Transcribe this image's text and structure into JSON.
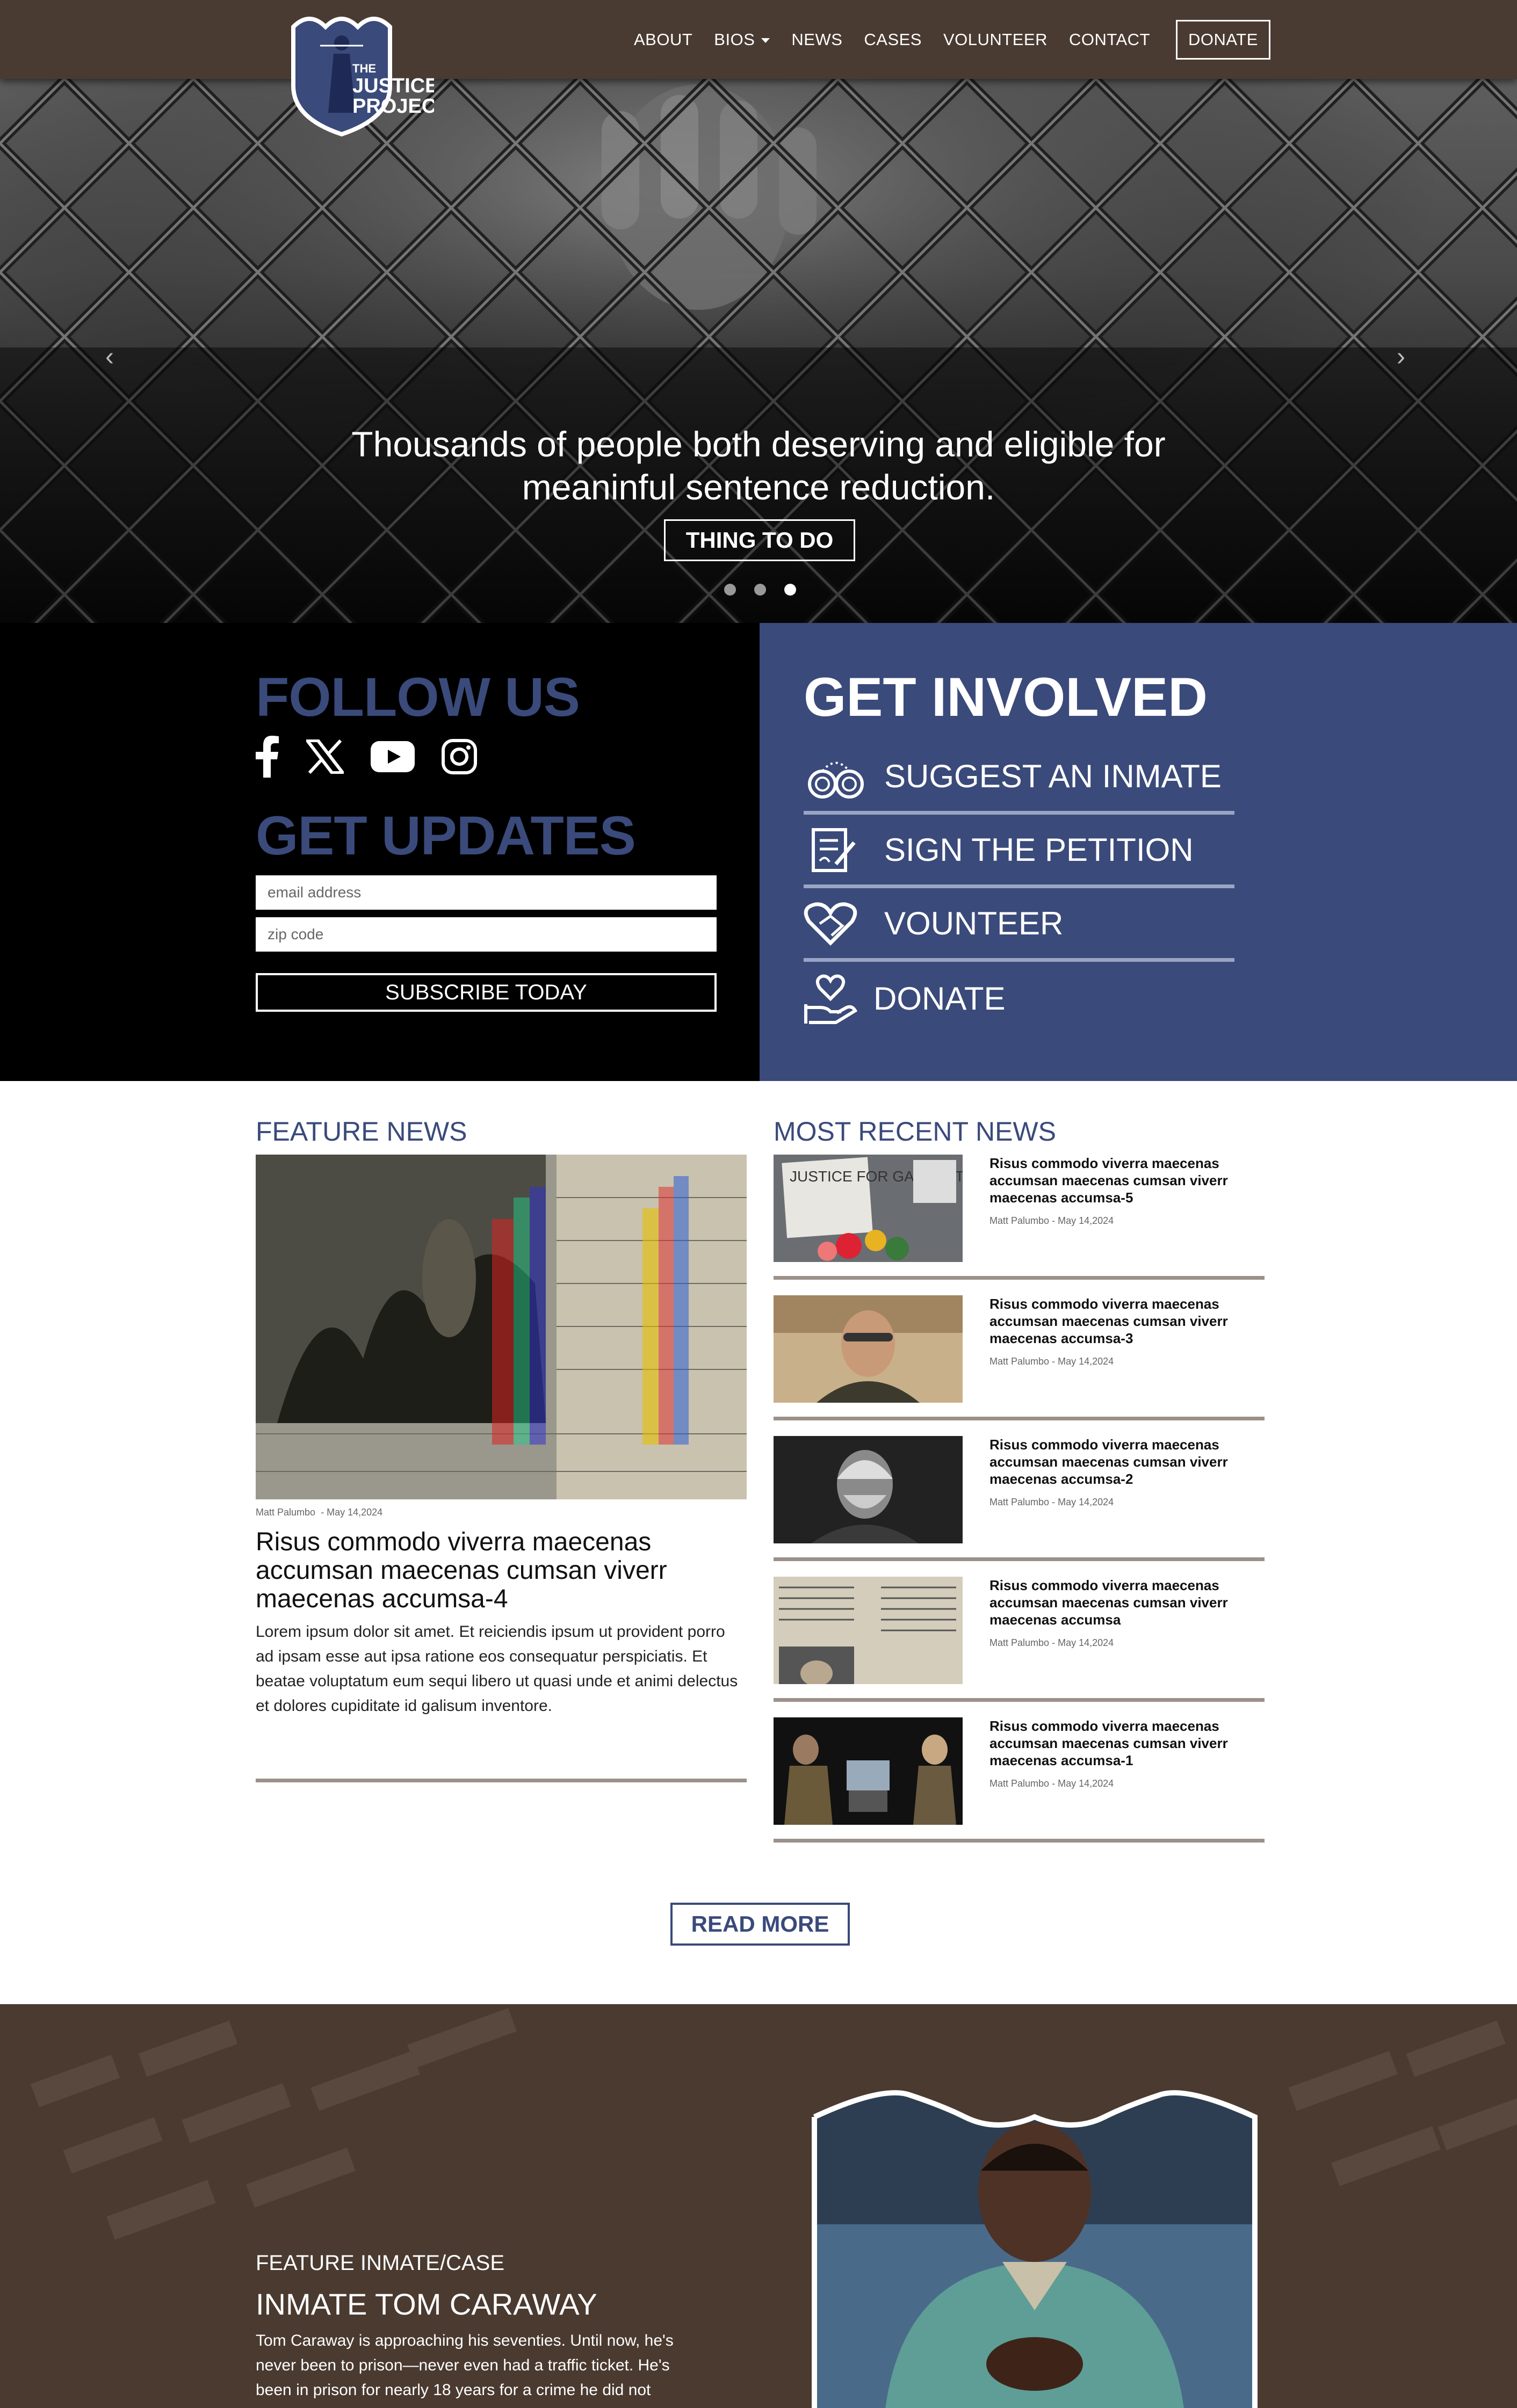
{
  "nav": {
    "logo_alt": "The Justice Project",
    "items": [
      {
        "label": "ABOUT"
      },
      {
        "label": "BIOS"
      },
      {
        "label": "NEWS"
      },
      {
        "label": "CASES"
      },
      {
        "label": "VOLUNTEER"
      },
      {
        "label": "CONTACT"
      }
    ],
    "donate": "DONATE"
  },
  "hero": {
    "line1": "Thousands of people both deserving and eligible for",
    "line2": "meaninful sentence reduction.",
    "button": "THING TO DO",
    "slides": 3,
    "active_slide": 3
  },
  "follow": {
    "title": "FOLLOW US",
    "social": [
      "facebook-icon",
      "x-icon",
      "youtube-icon",
      "instagram-icon"
    ],
    "updates_title": "GET UPDATES",
    "email_placeholder": "email address",
    "zip_placeholder": "zip code",
    "subscribe": "SUBSCRIBE TODAY"
  },
  "involved": {
    "title": "GET INVOLVED",
    "items": [
      {
        "label": "SUGGEST AN INMATE",
        "icon": "handcuffs-icon"
      },
      {
        "label": "SIGN THE PETITION",
        "icon": "petition-icon"
      },
      {
        "label": "VOUNTEER",
        "icon": "handshake-heart-icon"
      },
      {
        "label": "DONATE",
        "icon": "hand-heart-icon"
      }
    ]
  },
  "feature_news": {
    "section_title": "FEATURE NEWS",
    "author": "Matt Palumbo",
    "date": "- May 14,2024",
    "title": "Risus commodo viverra maecenas accumsan maecenas cumsan viverr maecenas accumsa-4",
    "body": "Lorem ipsum dolor sit amet. Et reiciendis ipsum ut provident porro ad ipsam esse aut ipsa ratione eos consequatur perspiciatis. Et beatae voluptatum eum sequi libero ut quasi unde et animi delectus et dolores cupiditate id galisum inventore."
  },
  "recent_news": {
    "section_title": "MOST RECENT NEWS",
    "items": [
      {
        "title": "Risus commodo viverra maecenas accumsan maecenas cumsan viverr maecenas accumsa-5",
        "author": "Matt Palumbo",
        "date": "- May 14,2024"
      },
      {
        "title": "Risus commodo viverra maecenas accumsan maecenas cumsan viverr maecenas accumsa-3",
        "author": "Matt Palumbo",
        "date": "- May 14,2024"
      },
      {
        "title": "Risus commodo viverra maecenas accumsan maecenas cumsan viverr maecenas accumsa-2",
        "author": "Matt Palumbo",
        "date": "- May 14,2024"
      },
      {
        "title": "Risus commodo viverra maecenas accumsan maecenas cumsan viverr maecenas accumsa",
        "author": "Matt Palumbo",
        "date": "- May 14,2024"
      },
      {
        "title": "Risus commodo viverra maecenas accumsan maecenas cumsan viverr maecenas accumsa-1",
        "author": "Matt Palumbo",
        "date": "- May 14,2024"
      }
    ],
    "thumb_sign_text": "JUSTICE FOR GARRETT FOSTER"
  },
  "read_more": "READ MORE",
  "inmate": {
    "label": "FEATURE INMATE/CASE",
    "title": "INMATE TOM CARAWAY",
    "body": "Tom Caraway is approaching his seventies. Until now, he's never been to prison—never even had a traffic ticket. He's been in prison for nearly 18 years for a crime he did not"
  },
  "colors": {
    "nav_bg": "#4a3b32",
    "brand_blue": "#3a4a7a",
    "divider": "#9b908a",
    "inmate_bg": "#4a3a30"
  }
}
